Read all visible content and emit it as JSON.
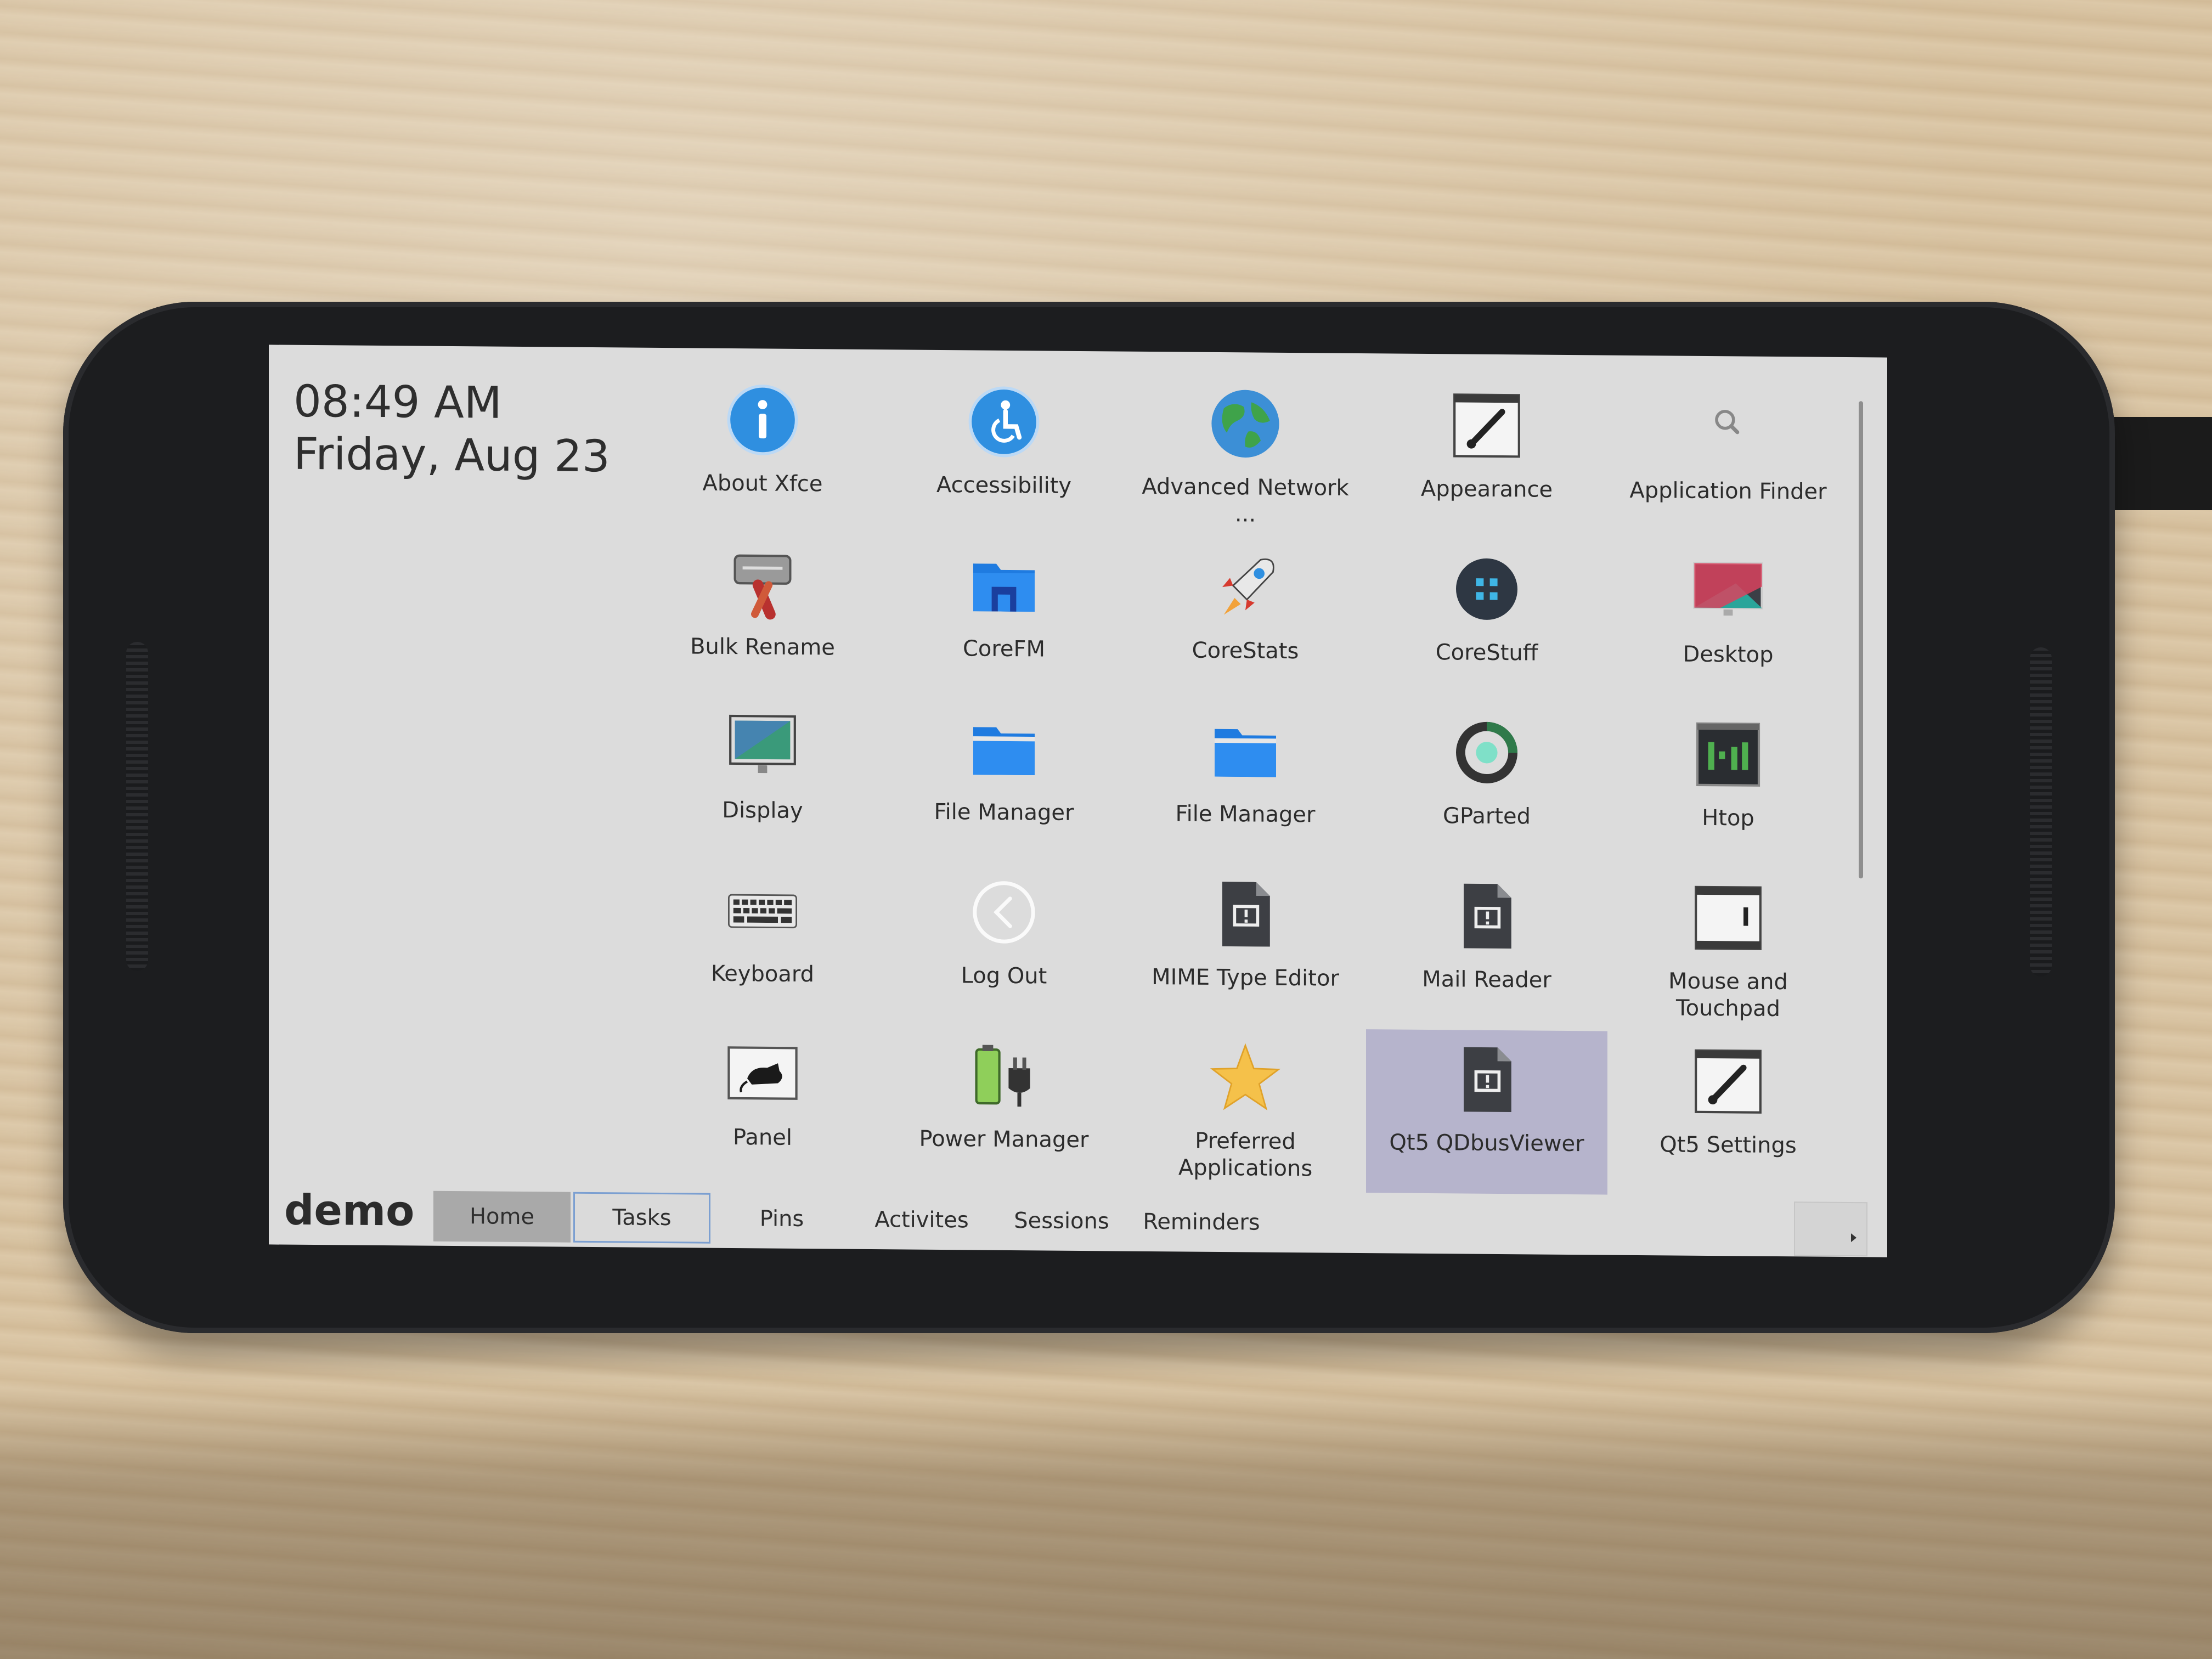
{
  "status": {
    "time": "08:49 AM",
    "date": "Friday, Aug 23"
  },
  "apps": [
    {
      "label": "About Xfce",
      "icon": "info-icon"
    },
    {
      "label": "Accessibility",
      "icon": "accessibility-icon"
    },
    {
      "label": "Advanced Network ...",
      "icon": "globe-icon"
    },
    {
      "label": "Appearance",
      "icon": "appearance-brush-icon"
    },
    {
      "label": "Application Finder",
      "icon": "search-icon"
    },
    {
      "label": "Bulk Rename",
      "icon": "bulk-rename-icon"
    },
    {
      "label": "CoreFM",
      "icon": "folder-icon"
    },
    {
      "label": "CoreStats",
      "icon": "rocket-icon"
    },
    {
      "label": "CoreStuff",
      "icon": "corestuff-icon"
    },
    {
      "label": "Desktop",
      "icon": "monitor-icon"
    },
    {
      "label": "Display",
      "icon": "display-icon"
    },
    {
      "label": "File Manager",
      "icon": "folder-icon"
    },
    {
      "label": "File Manager",
      "icon": "folder-icon"
    },
    {
      "label": "GParted",
      "icon": "gparted-icon"
    },
    {
      "label": "Htop",
      "icon": "htop-terminal-icon"
    },
    {
      "label": "Keyboard",
      "icon": "keyboard-icon"
    },
    {
      "label": "Log Out",
      "icon": "logout-icon"
    },
    {
      "label": "MIME Type Editor",
      "icon": "document-alert-icon"
    },
    {
      "label": "Mail Reader",
      "icon": "document-alert-icon"
    },
    {
      "label": "Mouse and Touchpad",
      "icon": "mouse-settings-icon"
    },
    {
      "label": "Panel",
      "icon": "panel-mouse-icon"
    },
    {
      "label": "Power Manager",
      "icon": "battery-plug-icon"
    },
    {
      "label": "Preferred Applications",
      "icon": "star-icon"
    },
    {
      "label": "Qt5 QDbusViewer",
      "icon": "document-alert-icon",
      "selected": true
    },
    {
      "label": "Qt5 Settings",
      "icon": "appearance-brush-icon"
    }
  ],
  "bottom": {
    "user": "demo",
    "tabs": [
      {
        "label": "Home",
        "state": "active"
      },
      {
        "label": "Tasks",
        "state": "focused"
      },
      {
        "label": "Pins"
      },
      {
        "label": "Activites"
      },
      {
        "label": "Sessions"
      },
      {
        "label": "Reminders"
      }
    ]
  },
  "colors": {
    "accent_blue": "#2f8fe0",
    "selected_bg": "#b6b4cc",
    "screen_bg": "#dcdcdc"
  }
}
